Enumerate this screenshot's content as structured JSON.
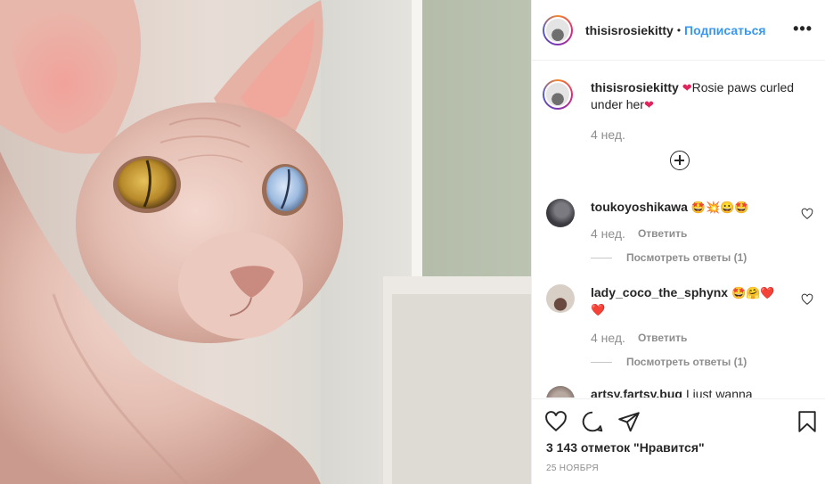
{
  "post": {
    "username": "thisisrosiekitty",
    "separator": "•",
    "follow_label": "Подписаться",
    "more_label": "•••"
  },
  "caption": {
    "username": "thisisrosiekitty",
    "text_before": "Rosie paws curled under her",
    "time": "4 нед."
  },
  "comments": [
    {
      "username": "toukoyoshikawa",
      "text": "🤩💥😀🤩",
      "time": "4 нед.",
      "reply_label": "Ответить",
      "view_replies": "Посмотреть ответы (1)"
    },
    {
      "username": "lady_coco_the_sphynx",
      "text": "🤩🤗❤️❤️",
      "time": "4 нед.",
      "reply_label": "Ответить",
      "view_replies": "Посмотреть ответы (1)"
    },
    {
      "username": "artsy.fartsy.bug",
      "text": "I just wanna"
    }
  ],
  "footer": {
    "likes": "3 143 отметок \"Нравится\"",
    "date": "25 НОЯБРЯ"
  },
  "icons": {
    "like": "heart-icon",
    "comment": "comment-icon",
    "share": "share-icon",
    "save": "bookmark-icon",
    "load_more": "plus-circle-icon"
  },
  "colors": {
    "follow": "#3897f0",
    "muted": "#8e8e8e",
    "heart_emoji": "#e0245e"
  }
}
